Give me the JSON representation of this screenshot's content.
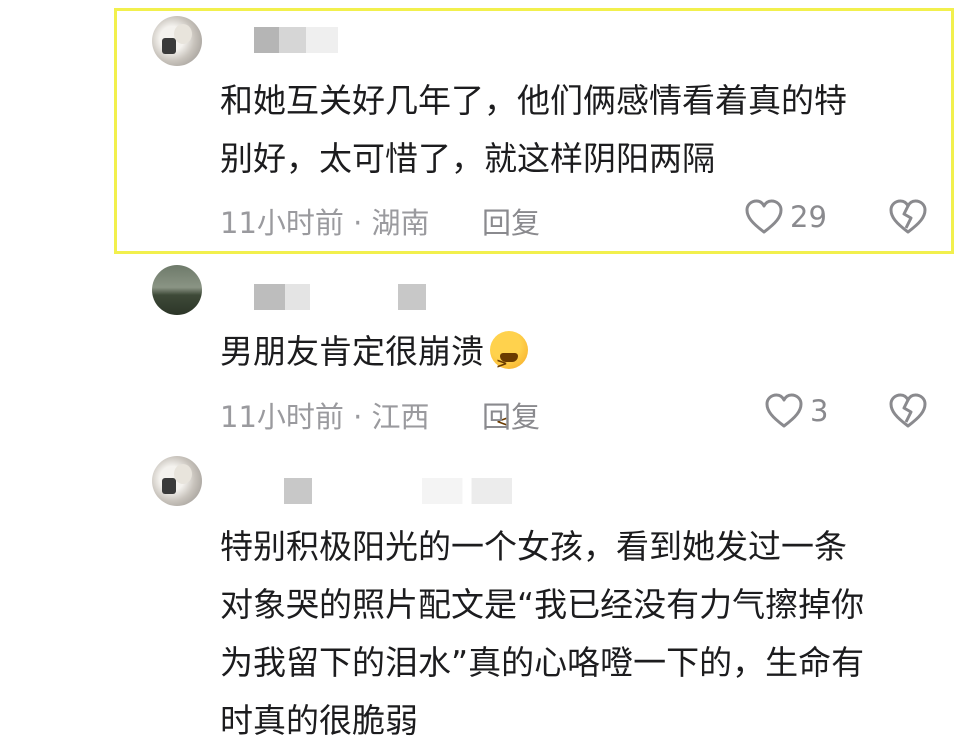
{
  "comments": [
    {
      "text_lines": [
        "和她互关好几年了，他们俩感情看着真的特",
        "别好，太可惜了，就这样阴阳两隔"
      ],
      "meta": "11小时前 · 湖南",
      "reply": "回复",
      "likes": "29"
    },
    {
      "text_lines": [
        "男朋友肯定很崩溃"
      ],
      "meta": "11小时前 · 江西",
      "reply": "回复",
      "likes": "3"
    },
    {
      "text_lines": [
        "特别积极阳光的一个女孩，看到她发过一条",
        "对象哭的照片配文是“我已经没有力气擦掉你",
        "为我留下的泪水”真的心咯噔一下的，生命有",
        "时真的很脆弱"
      ]
    }
  ],
  "icons": {
    "like": "heart-outline-icon",
    "dislike": "broken-heart-icon",
    "emoji": "tired-face-emoji"
  },
  "colors": {
    "highlight_border": "#f2f04d",
    "text": "#1c1c1e",
    "meta": "#9a9a9e"
  }
}
